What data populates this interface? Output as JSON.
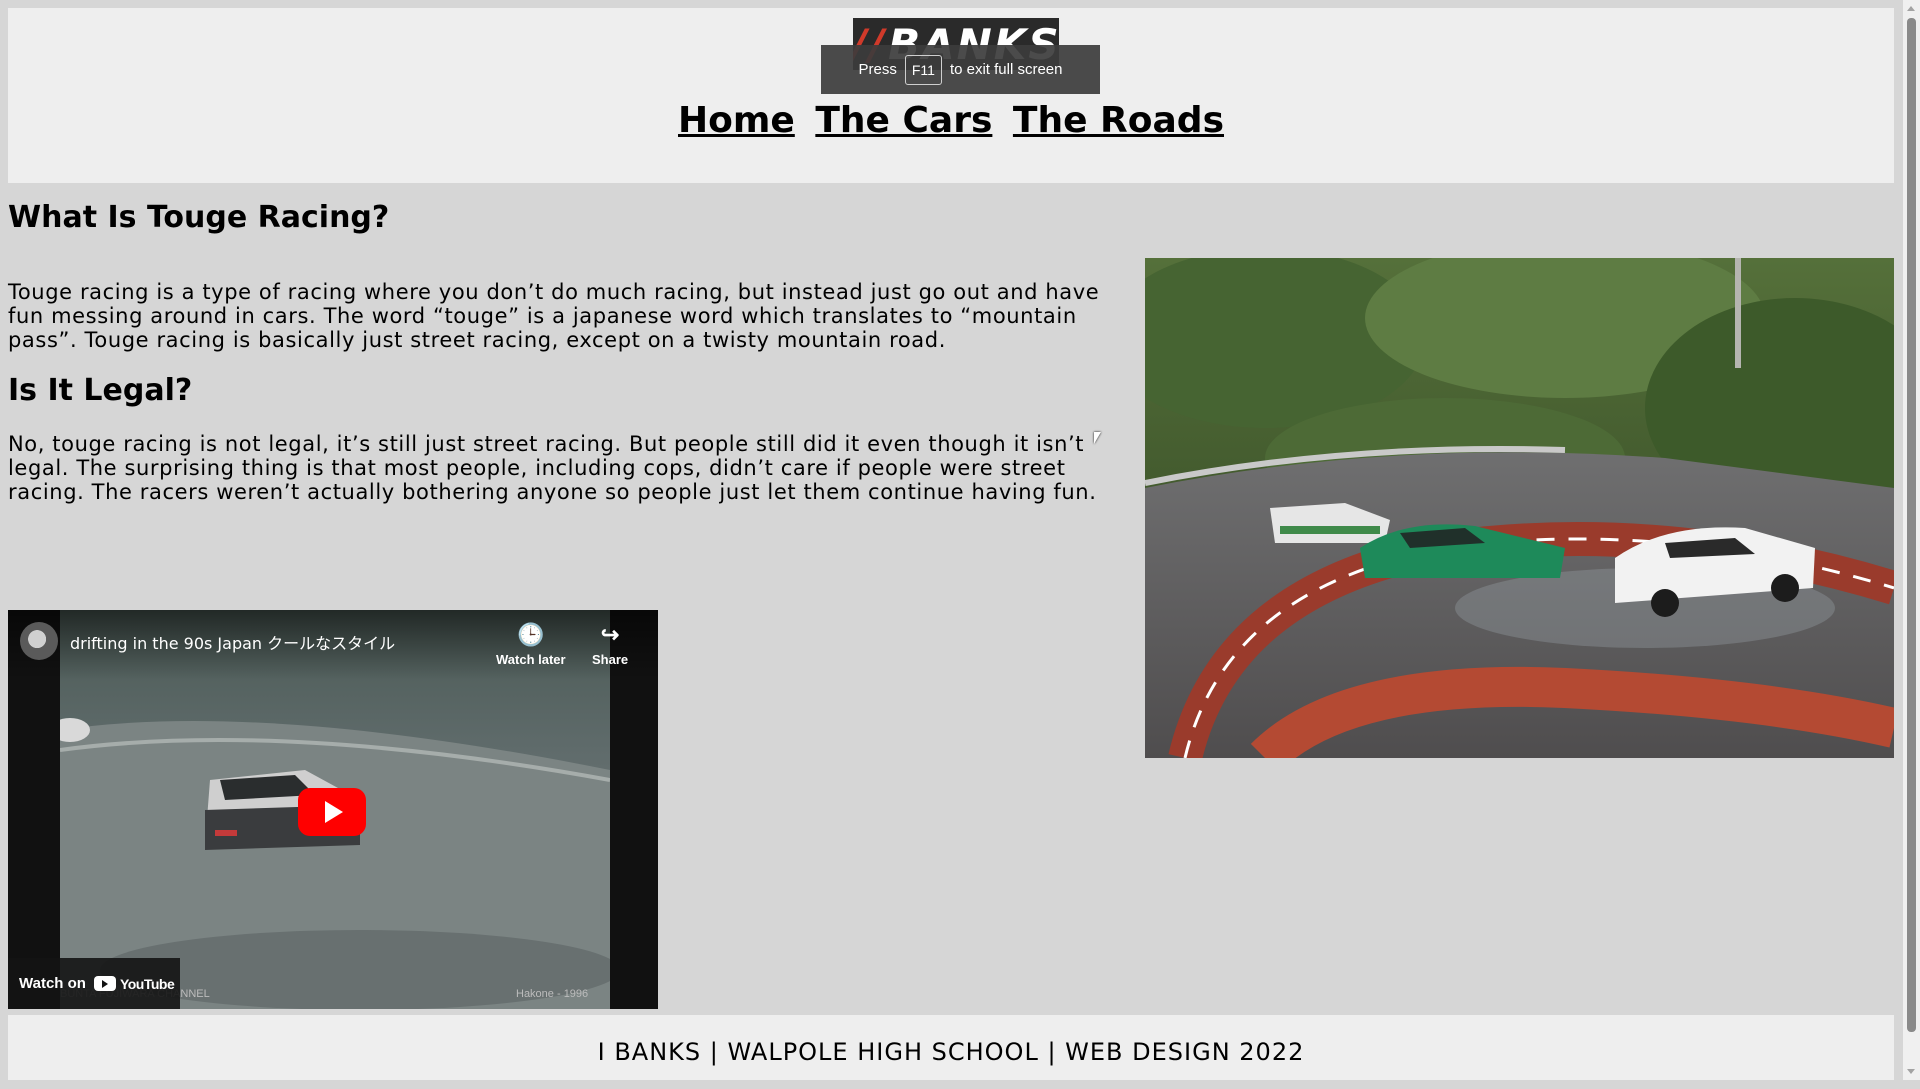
{
  "header": {
    "logo_text": "BANKS",
    "logo_prefix": "//",
    "fullscreen_notice": {
      "before": "Press",
      "key": "F11",
      "after": "to exit full screen"
    },
    "nav": [
      {
        "label": "Home"
      },
      {
        "label": "The Cars"
      },
      {
        "label": "The Roads"
      }
    ]
  },
  "content": {
    "heading1": "What Is Touge Racing?",
    "paragraph1": "Touge racing is a type of racing where you don’t do much racing, but instead just go out and have fun messing around in cars. The word “touge” is a japanese word which translates to “mountain pass”. Touge racing is basically just street racing, except on a twisty mountain road.",
    "heading2": "Is It Legal?",
    "paragraph2": "No, touge racing is not legal, it’s still just street racing. But people still did it even though it isn’t legal. The surprising thing is that most people, including cops, didn’t care if people were street racing. The racers weren’t actually bothering anyone so people just let them continue having fun."
  },
  "video": {
    "title": "drifting in the 90s Japan クールなスタイル",
    "watch_later": "Watch later",
    "share": "Share",
    "watch_on": "Watch on",
    "youtube": "YouTube",
    "caption_left": "BUNTA FUJIWARA CHANNEL",
    "caption_right": "Hakone - 1996"
  },
  "footer": {
    "text": "I BANKS | WALPOLE HIGH SCHOOL | WEB DESIGN 2022"
  },
  "colors": {
    "page_bg": "#d6d6d6",
    "header_bg": "#eeeeee",
    "logo_bg": "#2a2a2a",
    "logo_accent": "#d03a2a",
    "youtube_red": "#ff0000"
  }
}
